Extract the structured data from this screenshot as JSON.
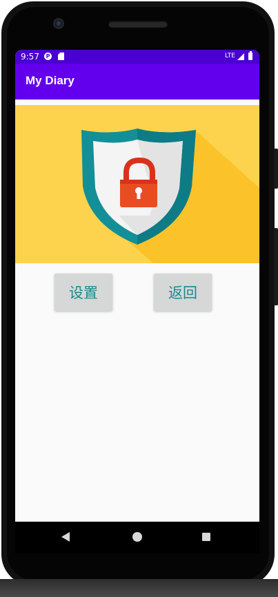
{
  "status_bar": {
    "time": "9:57",
    "network": "LTE",
    "icons": [
      "pocket-casts-icon",
      "sd-card-icon",
      "lte-icon",
      "signal-icon",
      "battery-icon"
    ]
  },
  "app_bar": {
    "title": "My Diary",
    "color": "#6200ee"
  },
  "banner": {
    "image": "security-shield-lock-illustration",
    "background_color": "#fdd34d"
  },
  "buttons": {
    "settings_label": "设置",
    "back_label": "返回",
    "text_color": "#1b8a8f"
  },
  "nav_bar": {
    "icons": [
      "back-triangle-icon",
      "home-circle-icon",
      "recents-square-icon"
    ]
  }
}
